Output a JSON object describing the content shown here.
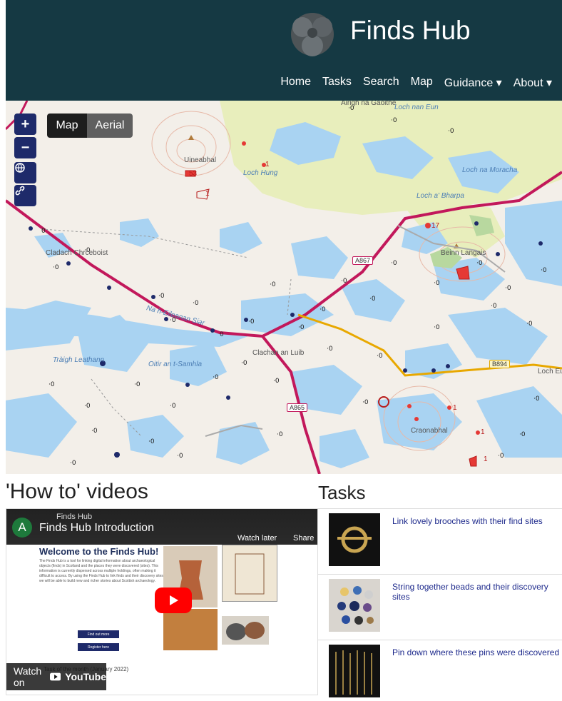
{
  "header": {
    "site_title": "Finds Hub",
    "nav": [
      "Home",
      "Tasks",
      "Search",
      "Map",
      "Guidance ▾",
      "About ▾"
    ]
  },
  "map": {
    "controls": {
      "zoom_in": "+",
      "zoom_out": "−"
    },
    "layer_map": "Map",
    "layer_aerial": "Aerial",
    "place_labels": [
      "Àirigh na Gaoithe",
      "Loch nan Eun",
      "Uineabhal",
      "Loch Hung",
      "Loch na Moracha",
      "Loch a' Bharpa",
      "Beinn Langais",
      "Cladach Chrceboist",
      "Na h-Eileanan Siar",
      "Clachan an Luib",
      "Tràigh Leathann",
      "Oitir an t-Samhla",
      "Craonabhal",
      "Loch Eu"
    ],
    "road_labels": [
      "A867",
      "B894",
      "A865"
    ],
    "counts": [
      "53",
      "1",
      "1",
      "17",
      "1",
      "1",
      "1"
    ]
  },
  "videos": {
    "heading": "'How to' videos",
    "channel": "Finds Hub",
    "title": "Finds Hub Introduction",
    "watch_later": "Watch later",
    "share": "Share",
    "welcome": "Welcome to the Finds Hub!",
    "welcome_text": "The Finds Hub is a tool for linking digital information about archaeological objects (finds) in Scotland and the places they were discovered (sites). This information is currently dispersed across multiple holdings, often making it difficult to access. By using the Finds Hub to link finds and their discovery sites, we will be able to build new and richer stories about Scottish archaeology.",
    "find_out": "Find out more",
    "register": "Register here",
    "task_of_month": "Task of the month (January 2022)",
    "watch_on": "Watch on",
    "youtube": "YouTube"
  },
  "tasks": {
    "heading": "Tasks",
    "items": [
      "Link lovely brooches with their find sites",
      "String together beads and their discovery sites",
      "Pin down where these pins were discovered"
    ]
  },
  "colors": {
    "header_bg": "#153943",
    "control_bg": "#1e2a6a",
    "road_a": "#c2185b",
    "road_b": "#e8a800"
  }
}
